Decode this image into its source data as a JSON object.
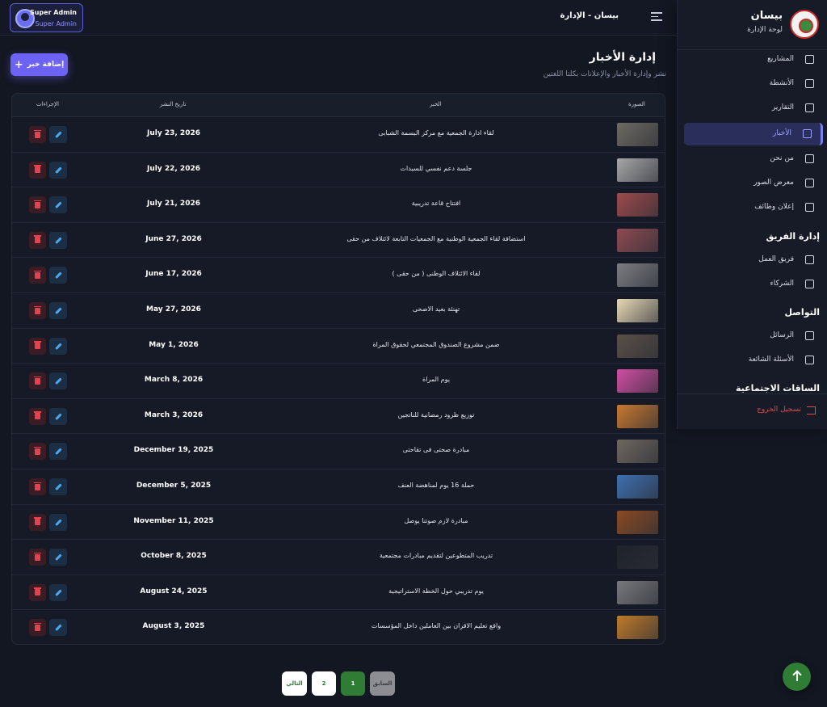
{
  "header": {
    "user_name": "Super Admin",
    "user_role": "Super Admin",
    "breadcrumb": "بيسان - الإدارة"
  },
  "page": {
    "title": "إدارة الأخبار",
    "subtitle": "نشر وإدارة الأخبار والإعلانات بكلتا اللغتين",
    "add_button": "إضافة خبر"
  },
  "table": {
    "headers": {
      "image": "الصورة",
      "title": "الخبر",
      "date": "تاريخ النشر",
      "actions": "الإجراءات"
    },
    "rows": [
      {
        "title": "لقاء ادارة الجمعية مع مركز البسمة الشبابى",
        "date": "July 23, 2026",
        "thumb": "#6e6a63"
      },
      {
        "title": "جلسة دعم نفسي للسيدات",
        "date": "July 22, 2026",
        "thumb": "#a7a7a8"
      },
      {
        "title": "افتتاح قاعة تدريبية",
        "date": "July 21, 2026",
        "thumb": "#9d4a4c"
      },
      {
        "title": "استضافة لقاء الجمعية الوطنية مع الجمعيات التابعة لائتلاف من حقى",
        "date": "June 27, 2026",
        "thumb": "#8f4a52"
      },
      {
        "title": "لقاء الائتلاف الوطنى ( من حقى )",
        "date": "June 17, 2026",
        "thumb": "#7b7d82"
      },
      {
        "title": "تهنئة بعيد الاضحى",
        "date": "May 27, 2026",
        "thumb": "#e7d8b5"
      },
      {
        "title": "ضمن مشروع الصندوق المجتمعي لحقوق المراة",
        "date": "May 1, 2026",
        "thumb": "#5a4f48"
      },
      {
        "title": "يوم المراة",
        "date": "March 8, 2026",
        "thumb": "#d24ea3"
      },
      {
        "title": "توزيع ظرود رمضانية للناتجين",
        "date": "March 3, 2026",
        "thumb": "#c8782f"
      },
      {
        "title": "مبادرة صحتى فى تقاحتى",
        "date": "December 19, 2025",
        "thumb": "#6e675f"
      },
      {
        "title": "حملة 16 يوم لمناهضة العنف",
        "date": "December 5, 2025",
        "thumb": "#3f6fb0"
      },
      {
        "title": "مبادرة لازم صوتنا يوصل",
        "date": "November 11, 2025",
        "thumb": "#8a4a23"
      },
      {
        "title": "تدريب المتطوعين لتقديم مبادرات مجتمعية",
        "date": "October 8, 2025",
        "thumb": "#1f232c"
      },
      {
        "title": "يوم تدريبي حول الخطة الاستراتيجية",
        "date": "August 24, 2025",
        "thumb": "#77797c"
      },
      {
        "title": "واقع تعليم الاقران بين العاملين داخل المؤسسات",
        "date": "August 3, 2025",
        "thumb": "#c07a2a"
      }
    ]
  },
  "pagination": {
    "prev": "السابق",
    "page1": "1",
    "page2": "2",
    "next": "التالي"
  },
  "sidebar": {
    "brand_name": "بيسان",
    "brand_sub": "لوحة الإدارة",
    "items": [
      {
        "label": "المشاريع",
        "icon": "clipboard-icon"
      },
      {
        "label": "الأنشطة",
        "icon": "calendar-icon"
      },
      {
        "label": "التقارير",
        "icon": "bar-chart-icon"
      },
      {
        "label": "الأخبار",
        "icon": "newspaper-icon"
      },
      {
        "label": "من نحن",
        "icon": "info-icon"
      },
      {
        "label": "معرض الصور",
        "icon": "photo-gallery-icon"
      },
      {
        "label": "إعلان وظائف",
        "icon": "megaphone-icon"
      }
    ],
    "team_title": "إدارة الفريق",
    "team_items": [
      {
        "label": "فريق العمل",
        "icon": "people-icon"
      },
      {
        "label": "الشركاء",
        "icon": "handshake-icon"
      }
    ],
    "contact_title": "التواصل",
    "contact_items": [
      {
        "label": "الرسائل",
        "icon": "chat-icon"
      },
      {
        "label": "الأسئلة الشائعة",
        "icon": "campaign-icon"
      }
    ],
    "social_title": "الساقات الاجتماعية",
    "logout": "تسجيل الخروج"
  },
  "colors": {
    "accent": "#6c62f4",
    "active_page": "#2f7d34",
    "delete": "#e4424f",
    "edit": "#4ba8f0",
    "logout": "#e24a4a"
  }
}
